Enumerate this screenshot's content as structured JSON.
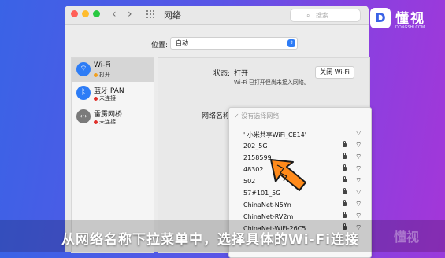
{
  "window": {
    "title": "网络",
    "search_placeholder": "搜索",
    "traffic_lights": [
      "#ff5f57",
      "#febc2e",
      "#28c840"
    ]
  },
  "location": {
    "label": "位置:",
    "value": "自动"
  },
  "services": [
    {
      "name": "Wi-Fi",
      "status": "打开",
      "status_color": "#f0a020",
      "icon": "wifi-icon",
      "icon_color": "#2d7cf6"
    },
    {
      "name": "蓝牙 PAN",
      "status": "未连接",
      "status_color": "#e0302a",
      "icon": "bluetooth-icon",
      "icon_color": "#2d7cf6"
    },
    {
      "name": "雷雳网桥",
      "status": "未连接",
      "status_color": "#e0302a",
      "icon": "thunderbolt-bridge-icon",
      "icon_color": "#7a7a7a"
    }
  ],
  "detail": {
    "status_label": "状态:",
    "status_value": "打开",
    "status_desc": "Wi-Fi 已打开但尚未接入网络。",
    "turn_off_button": "关闭 Wi-Fi",
    "network_name_label": "网络名称:"
  },
  "network_menu": {
    "header": "✓ 没有选择网络",
    "networks": [
      {
        "name": "' 小米共享WiFi_CE14'",
        "locked": false
      },
      {
        "name": "202_5G",
        "locked": true
      },
      {
        "name": "2158599",
        "locked": true
      },
      {
        "name": "48302",
        "locked": true
      },
      {
        "name": "502",
        "locked": true
      },
      {
        "name": "57#101_5G",
        "locked": true
      },
      {
        "name": "ChinaNet-N5Yn",
        "locked": true
      },
      {
        "name": "ChinaNet-RV2m",
        "locked": true
      },
      {
        "name": "ChinaNet-WiFi-26C5",
        "locked": true
      }
    ]
  },
  "brand": {
    "mark": "D",
    "name": "懂视",
    "sub": "DONGSHI.COM"
  },
  "caption": "从网络名称下拉菜单中，选择具体的Wi-Fi连接",
  "watermark": "懂视"
}
